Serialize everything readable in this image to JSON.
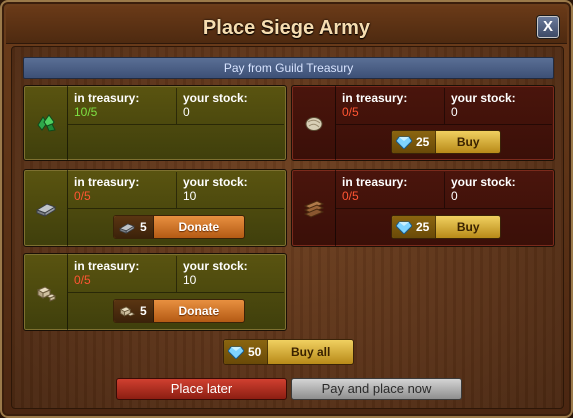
{
  "window": {
    "title": "Place Siege Army",
    "close_label": "X"
  },
  "section": {
    "header": "Pay from Guild Treasury"
  },
  "labels": {
    "in_treasury": "in treasury:",
    "your_stock": "your stock:"
  },
  "resources": [
    {
      "icon": "emerald-icon",
      "treasury": "10/5",
      "stock": "0",
      "status": "sufficient"
    },
    {
      "icon": "marble-icon",
      "treasury": "0/5",
      "stock": "0",
      "status": "buy",
      "cost": "25",
      "action": "Buy"
    },
    {
      "icon": "iron-icon",
      "treasury": "0/5",
      "stock": "10",
      "status": "donate",
      "cost": "5",
      "action": "Donate"
    },
    {
      "icon": "lumber-icon",
      "treasury": "0/5",
      "stock": "0",
      "status": "buy",
      "cost": "25",
      "action": "Buy"
    },
    {
      "icon": "limestone-icon",
      "treasury": "0/5",
      "stock": "10",
      "status": "donate",
      "cost": "5",
      "action": "Donate"
    }
  ],
  "buy_all": {
    "cost": "50",
    "label": "Buy all"
  },
  "footer": {
    "later_label": "Place later",
    "place_label": "Pay and place now"
  },
  "colors": {
    "sufficient": "#7ee043",
    "insufficient": "#ff5533",
    "header_blue": "#4a5d86",
    "card_green": "#4d4a0f",
    "card_red": "#44130b"
  }
}
